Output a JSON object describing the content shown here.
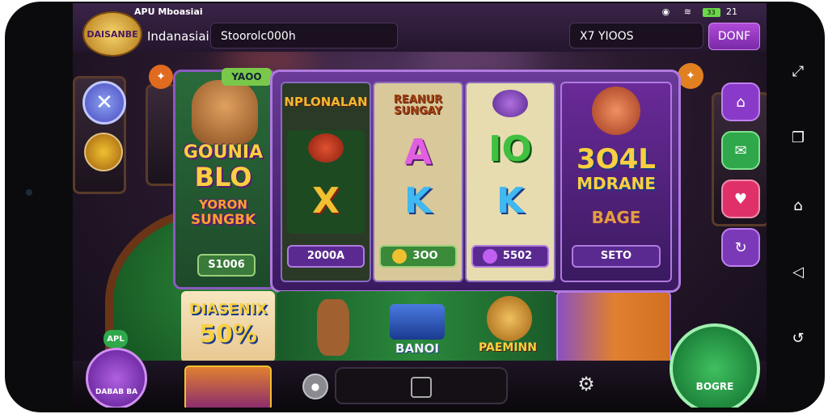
{
  "status_bar": {
    "app_title": "APU Mboasiai",
    "battery": "33",
    "time": "21"
  },
  "header": {
    "logo_text": "DAISANBE",
    "region": "Indanasiai",
    "search_value": "Stoorolc000h",
    "code_value": "X7 YIOOS",
    "done_label": "DONF"
  },
  "left_panel": {
    "top_label": "YAOO",
    "title_line1": "GOUNIA",
    "title_line2": "BLO",
    "subtitle_line1": "YORON",
    "subtitle_line2": "SUNGBK",
    "value": "S1006"
  },
  "reels": [
    {
      "title": "NPLONALAN",
      "symbol": "X",
      "value": "2000A",
      "symbol_color": "#f0c030"
    },
    {
      "title": "REANUR SUNGAY",
      "symbol_top": "A",
      "symbol": "K",
      "value": "3OO",
      "symbol_color": "#40b8f0"
    },
    {
      "title": "",
      "symbol_top": "IO",
      "symbol": "K",
      "value": "5502",
      "symbol_color": "#40b8f0"
    }
  ],
  "jackpot": {
    "line1": "3O4L",
    "line2": "MDRANE",
    "line3": "BAGE",
    "value": "SETO"
  },
  "thumbnails": {
    "promo_title": "DIASENIX",
    "promo_value": "50%",
    "bank_label": "BANOI",
    "premium_label": "PAEMINN"
  },
  "bottom": {
    "apl_label": "APL",
    "chip_label": "DABAB BA",
    "play_label": "BOGRE"
  },
  "colors": {
    "accent_purple": "#8a4ac8",
    "gold": "#f0c030",
    "green": "#2ea84a"
  }
}
